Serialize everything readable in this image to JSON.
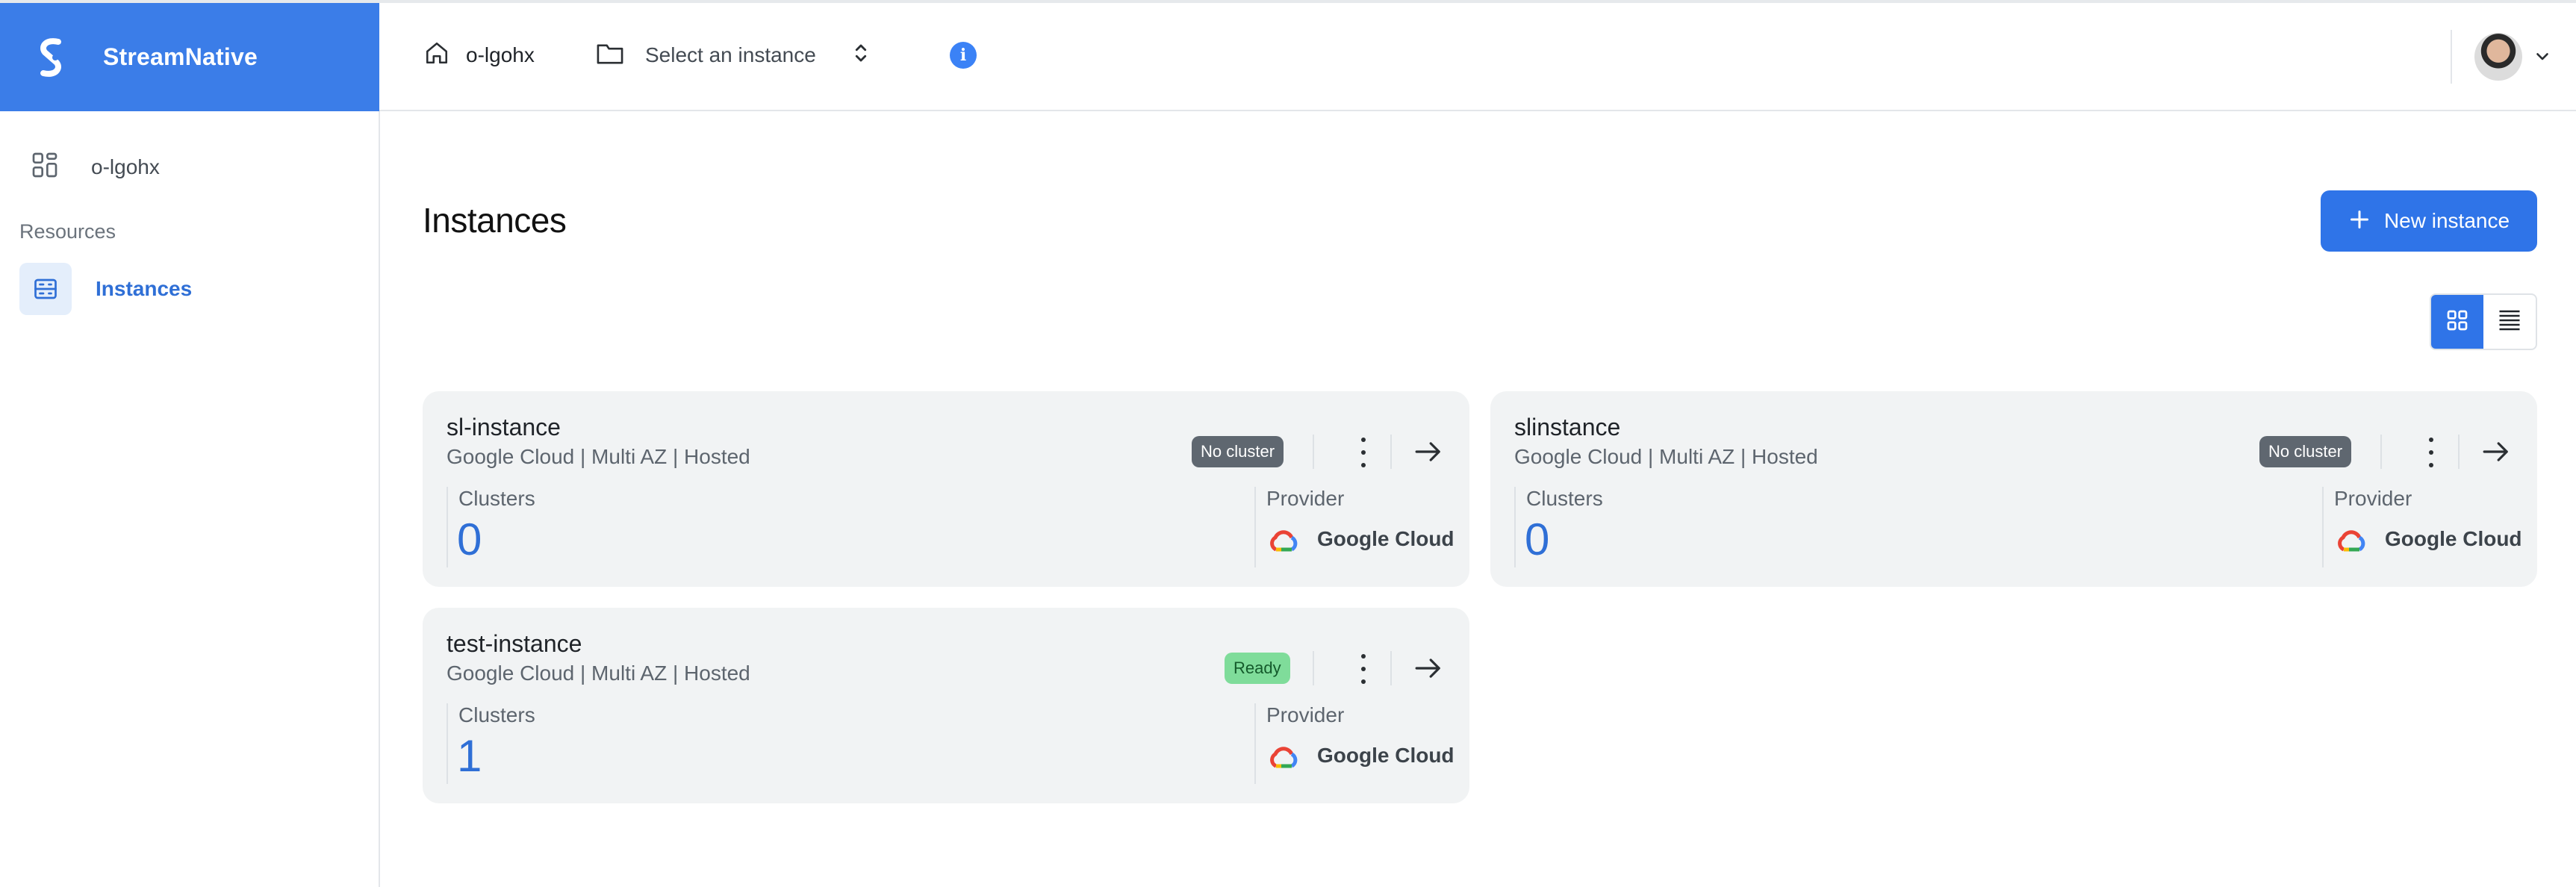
{
  "brand": {
    "name": "StreamNative"
  },
  "header": {
    "org_label": "o-lgohx",
    "instance_selector": "Select an instance",
    "info": "i"
  },
  "sidebar": {
    "org_label": "o-lgohx",
    "section_label": "Resources",
    "items": [
      {
        "label": "Instances",
        "active": true
      }
    ]
  },
  "main": {
    "title": "Instances",
    "new_button": "New instance",
    "view_mode": "grid",
    "cards": [
      {
        "name": "sl-instance",
        "meta": "Google Cloud | Multi AZ | Hosted",
        "status": "No cluster",
        "clusters_label": "Clusters",
        "clusters": "0",
        "provider_label": "Provider",
        "provider": "Google Cloud"
      },
      {
        "name": "slinstance",
        "meta": "Google Cloud | Multi AZ | Hosted",
        "status": "No cluster",
        "clusters_label": "Clusters",
        "clusters": "0",
        "provider_label": "Provider",
        "provider": "Google Cloud"
      },
      {
        "name": "test-instance",
        "meta": "Google Cloud | Multi AZ | Hosted",
        "status": "Ready",
        "clusters_label": "Clusters",
        "clusters": "1",
        "provider_label": "Provider",
        "provider": "Google Cloud"
      }
    ]
  },
  "colors": {
    "brand": "#3b7de8",
    "accent": "#2f74e8",
    "badge_no_cluster": "#5f6770",
    "badge_ready": "#7fdc9a",
    "card_bg": "#f1f3f4"
  },
  "icons": {
    "home": "home-icon",
    "folder": "folder-icon",
    "selector": "chevron-up-down-icon",
    "info": "info-icon",
    "dashboard": "grid-dashboard-icon",
    "instances": "server-icon",
    "add": "plus-icon",
    "grid_view": "grid-view-icon",
    "list_view": "list-view-icon",
    "more": "kebab-menu-icon",
    "open": "arrow-right-icon",
    "provider": "google-cloud-logo-icon"
  }
}
